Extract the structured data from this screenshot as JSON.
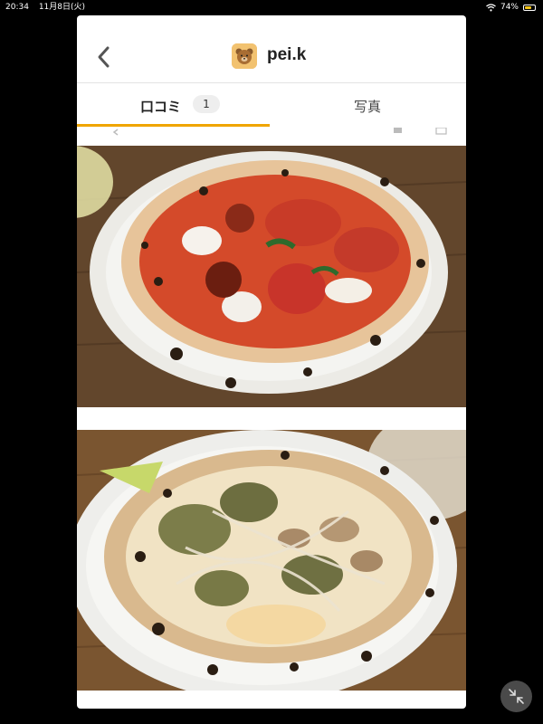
{
  "status_bar": {
    "time": "20:34",
    "date": "11月8日(火)",
    "battery": "74%",
    "battery_level": 0.74
  },
  "header": {
    "username": "pei.k"
  },
  "tabs": [
    {
      "label": "口コミ",
      "count": "1"
    },
    {
      "label": "写真"
    }
  ],
  "icons": {
    "back": "chevron-left-icon",
    "wifi": "wifi-icon",
    "battery": "battery-icon",
    "minimize": "collapse-arrows-icon"
  },
  "colors": {
    "accent": "#f0a500",
    "battery": "#f5c518"
  }
}
